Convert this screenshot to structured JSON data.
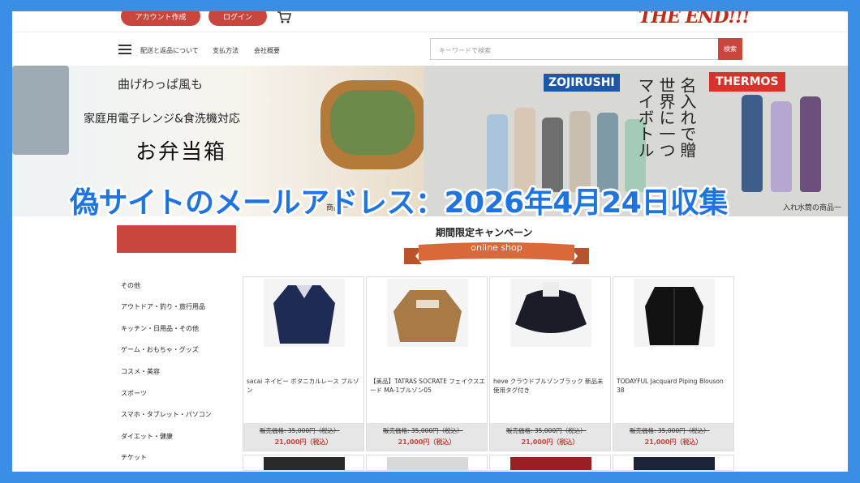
{
  "header": {
    "create_account": "アカウント作成",
    "login": "ログイン",
    "cart_icon": "cart-icon",
    "brand": "THE END!!!"
  },
  "nav": {
    "menu_icon": "hamburger-menu-icon",
    "links": [
      "配送と返品について",
      "支払方法",
      "会社概要"
    ],
    "search_placeholder": "キーワードで検索",
    "search_button": "検索"
  },
  "banners": {
    "left": {
      "subtitle": "曲げわっぱ風も",
      "description": "家庭用電子レンジ&食洗機対応",
      "headline": "お弁当箱",
      "caption": "商品一"
    },
    "right": {
      "brand1": "ZOJIRUSHI",
      "brand2": "THERMOS",
      "vertical_text": [
        "名入れで贈",
        "世界に一つ",
        "マイボトル"
      ],
      "caption": "入れ水筒の商品一"
    }
  },
  "sidebar": {
    "items": [
      "その他",
      "アウトドア・釣り・旅行用品",
      "キッチン・日用品・その他",
      "ゲーム・おもちゃ・グッズ",
      "コスメ・美容",
      "スポーツ",
      "スマホ・タブレット・パソコン",
      "ダイエット・健康",
      "チケット"
    ]
  },
  "campaign": {
    "title": "期間限定キャンペーン",
    "ribbon": "online shop"
  },
  "products": [
    {
      "name": "sacai ネイビー ボタニカルレース ブルゾン",
      "original_price": "販売価格: 35,000円（税込）",
      "price": "21,000円（税込）"
    },
    {
      "name": "【美品】TATRAS SOCRATE フェイクスエード MA-1ブルゾン05",
      "original_price": "販売価格: 35,000円（税込）",
      "price": "21,000円（税込）"
    },
    {
      "name": "heve クラウドブルゾンブラック 新品未使用タグ付き",
      "original_price": "販売価格: 35,000円（税込）",
      "price": "21,000円（税込）"
    },
    {
      "name": "TODAYFUL Jacquard Piping Blouson 38",
      "original_price": "販売価格: 35,000円（税込）",
      "price": "21,000円（税込）"
    }
  ],
  "overlay": {
    "headline": "偽サイトのメールアドレス：2026年4月24日収集"
  },
  "colors": {
    "accent_red": "#c8463e",
    "overlay_blue": "#1f74e0",
    "frame_blue": "#3a8ee6"
  }
}
